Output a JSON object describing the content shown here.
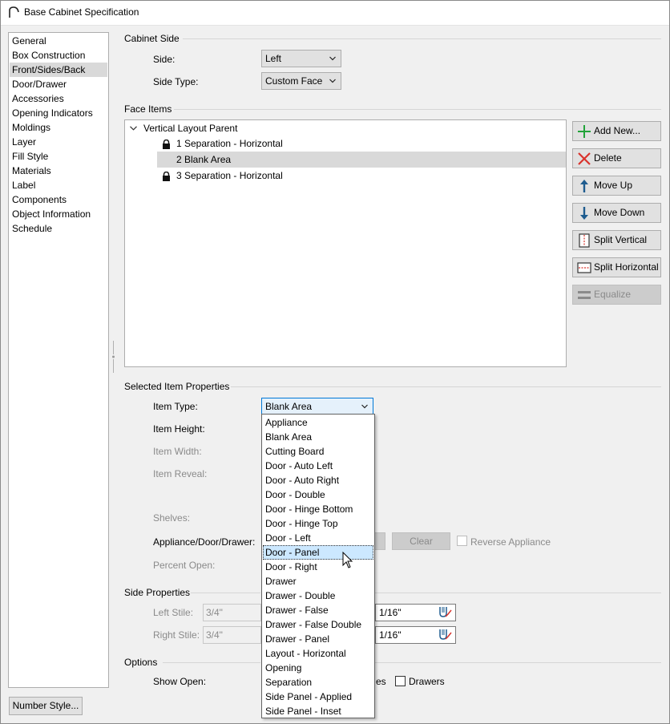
{
  "window": {
    "title": "Base Cabinet Specification"
  },
  "categories": [
    "General",
    "Box Construction",
    "Front/Sides/Back",
    "Door/Drawer",
    "Accessories",
    "Opening Indicators",
    "Moldings",
    "Layer",
    "Fill Style",
    "Materials",
    "Label",
    "Components",
    "Object Information",
    "Schedule"
  ],
  "selected_category": "Front/Sides/Back",
  "cabinet_side": {
    "group_label": "Cabinet Side",
    "side_label": "Side:",
    "side_value": "Left",
    "side_type_label": "Side Type:",
    "side_type_value": "Custom Face"
  },
  "face_items": {
    "group_label": "Face Items",
    "parent": "Vertical Layout Parent",
    "children": [
      {
        "label": "1 Separation - Horizontal",
        "locked": true
      },
      {
        "label": "2 Blank Area",
        "locked": false,
        "selected": true
      },
      {
        "label": "3 Separation - Horizontal",
        "locked": true
      }
    ],
    "buttons": {
      "add_new": "Add New...",
      "delete": "Delete",
      "move_up": "Move Up",
      "move_down": "Move Down",
      "split_vertical": "Split Vertical",
      "split_horizontal": "Split Horizontal",
      "equalize": "Equalize"
    }
  },
  "selected_item_properties": {
    "group_label": "Selected Item Properties",
    "item_type_label": "Item Type:",
    "item_type_value": "Blank Area",
    "item_height_label": "Item Height:",
    "item_width_label": "Item Width:",
    "item_reveal_label": "Item Reveal:",
    "shelves_label": "Shelves:",
    "appliance_label": "Appliance/Door/Drawer:",
    "clear_button": "Clear",
    "reverse_appliance_label": "Reverse Appliance",
    "percent_open_label": "Percent Open:"
  },
  "item_type_options": [
    "Appliance",
    "Blank Area",
    "Cutting Board",
    "Door - Auto Left",
    "Door - Auto Right",
    "Door - Double",
    "Door - Hinge Bottom",
    "Door - Hinge Top",
    "Door - Left",
    "Door - Panel",
    "Door - Right",
    "Drawer",
    "Drawer - Double",
    "Drawer - False",
    "Drawer - False Double",
    "Drawer - Panel",
    "Layout - Horizontal",
    "Opening",
    "Separation",
    "Side Panel - Applied",
    "Side Panel - Inset"
  ],
  "hovered_option": "Door - Panel",
  "side_properties": {
    "group_label": "Side Properties",
    "left_stile_label": "Left Stile:",
    "left_stile_value": "3/4\"",
    "left_other_value": "1/16\"",
    "right_stile_label": "Right Stile:",
    "right_stile_value": "3/4\"",
    "right_other_value": "1/16\""
  },
  "options": {
    "group_label": "Options",
    "show_open_label": "Show Open:",
    "doors_partial": "es",
    "drawers_label": "Drawers"
  },
  "number_style_button": "Number Style...",
  "colors": {
    "dialog_bg": "#f0f0f0",
    "selection": "#d9d9d9",
    "hover_item": "#cce8ff",
    "accent_blue": "#0078d7",
    "add_green": "#22a33a",
    "delete_red": "#d9332c",
    "arrow_blue": "#1e5c8f"
  }
}
